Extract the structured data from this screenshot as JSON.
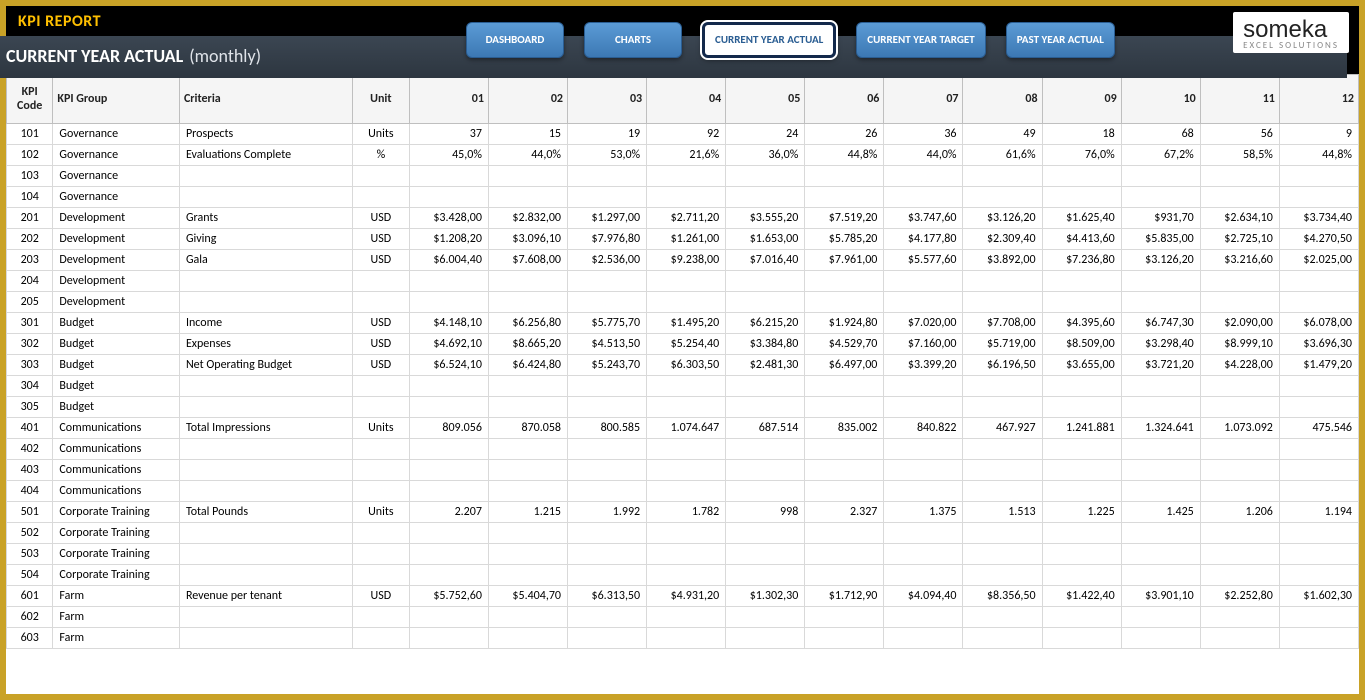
{
  "header": {
    "report_title": "KPI REPORT",
    "subtitle_main": "CURRENT YEAR ACTUAL",
    "subtitle_paren": "(monthly)"
  },
  "nav": {
    "dashboard": "DASHBOARD",
    "charts": "CHARTS",
    "current_actual": "CURRENT YEAR ACTUAL",
    "current_target": "CURRENT YEAR TARGET",
    "past_actual": "PAST YEAR ACTUAL"
  },
  "logo": {
    "main": "someka",
    "sub": "EXCEL SOLUTIONS"
  },
  "columns": {
    "code": "KPI Code",
    "group": "KPI Group",
    "criteria": "Criteria",
    "unit": "Unit",
    "m01": "01",
    "m02": "02",
    "m03": "03",
    "m04": "04",
    "m05": "05",
    "m06": "06",
    "m07": "07",
    "m08": "08",
    "m09": "09",
    "m10": "10",
    "m11": "11",
    "m12": "12"
  },
  "rows": [
    {
      "code": "101",
      "group": "Governance",
      "criteria": "Prospects",
      "unit": "Units",
      "v": [
        "37",
        "15",
        "19",
        "92",
        "24",
        "26",
        "36",
        "49",
        "18",
        "68",
        "56",
        "9"
      ]
    },
    {
      "code": "102",
      "group": "Governance",
      "criteria": "Evaluations Complete",
      "unit": "%",
      "v": [
        "45,0%",
        "44,0%",
        "53,0%",
        "21,6%",
        "36,0%",
        "44,8%",
        "44,0%",
        "61,6%",
        "76,0%",
        "67,2%",
        "58,5%",
        "44,8%"
      ]
    },
    {
      "code": "103",
      "group": "Governance",
      "criteria": "",
      "unit": "",
      "v": [
        "",
        "",
        "",
        "",
        "",
        "",
        "",
        "",
        "",
        "",
        "",
        ""
      ]
    },
    {
      "code": "104",
      "group": "Governance",
      "criteria": "",
      "unit": "",
      "v": [
        "",
        "",
        "",
        "",
        "",
        "",
        "",
        "",
        "",
        "",
        "",
        ""
      ]
    },
    {
      "code": "201",
      "group": "Development",
      "criteria": "Grants",
      "unit": "USD",
      "v": [
        "$3.428,00",
        "$2.832,00",
        "$1.297,00",
        "$2.711,20",
        "$3.555,20",
        "$7.519,20",
        "$3.747,60",
        "$3.126,20",
        "$1.625,40",
        "$931,70",
        "$2.634,10",
        "$3.734,40"
      ]
    },
    {
      "code": "202",
      "group": "Development",
      "criteria": "Giving",
      "unit": "USD",
      "v": [
        "$1.208,20",
        "$3.096,10",
        "$7.976,80",
        "$1.261,00",
        "$1.653,00",
        "$5.785,20",
        "$4.177,80",
        "$2.309,40",
        "$4.413,60",
        "$5.835,00",
        "$2.725,10",
        "$4.270,50"
      ]
    },
    {
      "code": "203",
      "group": "Development",
      "criteria": "Gala",
      "unit": "USD",
      "v": [
        "$6.004,40",
        "$7.608,00",
        "$2.536,00",
        "$9.238,00",
        "$7.016,40",
        "$7.961,00",
        "$5.577,60",
        "$3.892,00",
        "$7.236,80",
        "$3.126,20",
        "$3.216,60",
        "$2.025,00"
      ]
    },
    {
      "code": "204",
      "group": "Development",
      "criteria": "",
      "unit": "",
      "v": [
        "",
        "",
        "",
        "",
        "",
        "",
        "",
        "",
        "",
        "",
        "",
        ""
      ]
    },
    {
      "code": "205",
      "group": "Development",
      "criteria": "",
      "unit": "",
      "v": [
        "",
        "",
        "",
        "",
        "",
        "",
        "",
        "",
        "",
        "",
        "",
        ""
      ]
    },
    {
      "code": "301",
      "group": "Budget",
      "criteria": "Income",
      "unit": "USD",
      "v": [
        "$4.148,10",
        "$6.256,80",
        "$5.775,70",
        "$1.495,20",
        "$6.215,20",
        "$1.924,80",
        "$7.020,00",
        "$7.708,00",
        "$4.395,60",
        "$6.747,30",
        "$2.090,00",
        "$6.078,00"
      ]
    },
    {
      "code": "302",
      "group": "Budget",
      "criteria": "Expenses",
      "unit": "USD",
      "v": [
        "$4.692,10",
        "$8.665,20",
        "$4.513,50",
        "$5.254,40",
        "$3.384,80",
        "$4.529,70",
        "$7.160,00",
        "$5.719,00",
        "$8.509,00",
        "$3.298,40",
        "$8.999,10",
        "$3.696,30"
      ]
    },
    {
      "code": "303",
      "group": "Budget",
      "criteria": "Net Operating Budget",
      "unit": "USD",
      "v": [
        "$6.524,10",
        "$6.424,80",
        "$5.243,70",
        "$6.303,50",
        "$2.481,30",
        "$6.497,00",
        "$3.399,20",
        "$6.196,50",
        "$3.655,00",
        "$3.721,20",
        "$4.228,00",
        "$1.479,20"
      ]
    },
    {
      "code": "304",
      "group": "Budget",
      "criteria": "",
      "unit": "",
      "v": [
        "",
        "",
        "",
        "",
        "",
        "",
        "",
        "",
        "",
        "",
        "",
        ""
      ]
    },
    {
      "code": "305",
      "group": "Budget",
      "criteria": "",
      "unit": "",
      "v": [
        "",
        "",
        "",
        "",
        "",
        "",
        "",
        "",
        "",
        "",
        "",
        ""
      ]
    },
    {
      "code": "401",
      "group": "Communications",
      "criteria": "Total Impressions",
      "unit": "Units",
      "v": [
        "809.056",
        "870.058",
        "800.585",
        "1.074.647",
        "687.514",
        "835.002",
        "840.822",
        "467.927",
        "1.241.881",
        "1.324.641",
        "1.073.092",
        "475.546"
      ]
    },
    {
      "code": "402",
      "group": "Communications",
      "criteria": "",
      "unit": "",
      "v": [
        "",
        "",
        "",
        "",
        "",
        "",
        "",
        "",
        "",
        "",
        "",
        ""
      ]
    },
    {
      "code": "403",
      "group": "Communications",
      "criteria": "",
      "unit": "",
      "v": [
        "",
        "",
        "",
        "",
        "",
        "",
        "",
        "",
        "",
        "",
        "",
        ""
      ]
    },
    {
      "code": "404",
      "group": "Communications",
      "criteria": "",
      "unit": "",
      "v": [
        "",
        "",
        "",
        "",
        "",
        "",
        "",
        "",
        "",
        "",
        "",
        ""
      ]
    },
    {
      "code": "501",
      "group": "Corporate Training",
      "criteria": "Total Pounds",
      "unit": "Units",
      "v": [
        "2.207",
        "1.215",
        "1.992",
        "1.782",
        "998",
        "2.327",
        "1.375",
        "1.513",
        "1.225",
        "1.425",
        "1.206",
        "1.194"
      ]
    },
    {
      "code": "502",
      "group": "Corporate Training",
      "criteria": "",
      "unit": "",
      "v": [
        "",
        "",
        "",
        "",
        "",
        "",
        "",
        "",
        "",
        "",
        "",
        ""
      ]
    },
    {
      "code": "503",
      "group": "Corporate Training",
      "criteria": "",
      "unit": "",
      "v": [
        "",
        "",
        "",
        "",
        "",
        "",
        "",
        "",
        "",
        "",
        "",
        ""
      ]
    },
    {
      "code": "504",
      "group": "Corporate Training",
      "criteria": "",
      "unit": "",
      "v": [
        "",
        "",
        "",
        "",
        "",
        "",
        "",
        "",
        "",
        "",
        "",
        ""
      ]
    },
    {
      "code": "601",
      "group": "Farm",
      "criteria": "Revenue per tenant",
      "unit": "USD",
      "v": [
        "$5.752,60",
        "$5.404,70",
        "$6.313,50",
        "$4.931,20",
        "$1.302,30",
        "$1.712,90",
        "$4.094,40",
        "$8.356,50",
        "$1.422,40",
        "$3.901,10",
        "$2.252,80",
        "$1.602,30"
      ]
    },
    {
      "code": "602",
      "group": "Farm",
      "criteria": "",
      "unit": "",
      "v": [
        "",
        "",
        "",
        "",
        "",
        "",
        "",
        "",
        "",
        "",
        "",
        ""
      ]
    },
    {
      "code": "603",
      "group": "Farm",
      "criteria": "",
      "unit": "",
      "v": [
        "",
        "",
        "",
        "",
        "",
        "",
        "",
        "",
        "",
        "",
        "",
        ""
      ]
    }
  ]
}
